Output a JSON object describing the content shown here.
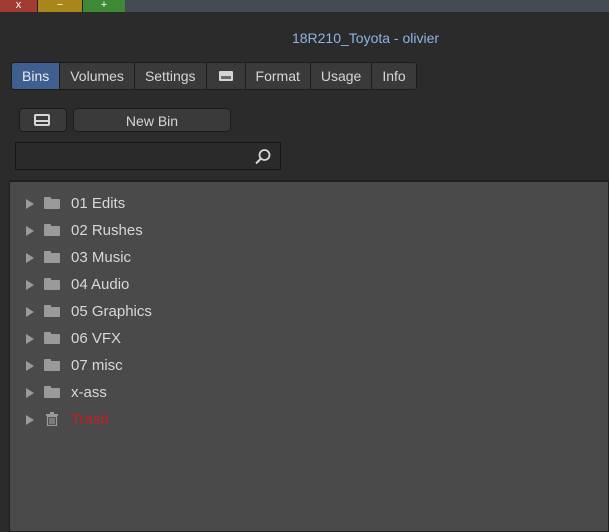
{
  "window": {
    "buttons": {
      "close": "x",
      "minimize": "−",
      "maximize": "+"
    },
    "title": "18R210_Toyota - olivier"
  },
  "tabs": [
    {
      "label": "Bins",
      "active": true
    },
    {
      "label": "Volumes",
      "active": false
    },
    {
      "label": "Settings",
      "active": false
    },
    {
      "label": "",
      "icon": "monitor-icon",
      "active": false
    },
    {
      "label": "Format",
      "active": false
    },
    {
      "label": "Usage",
      "active": false
    },
    {
      "label": "Info",
      "active": false
    }
  ],
  "toolbar": {
    "layout_icon": "layout-split-icon",
    "new_bin_label": "New Bin"
  },
  "search": {
    "value": "",
    "placeholder": "",
    "icon": "search-icon"
  },
  "bins": [
    {
      "label": "01 Edits",
      "icon": "folder-icon"
    },
    {
      "label": "02 Rushes",
      "icon": "folder-icon"
    },
    {
      "label": "03 Music",
      "icon": "folder-icon"
    },
    {
      "label": "04 Audio",
      "icon": "folder-icon"
    },
    {
      "label": "05 Graphics",
      "icon": "folder-icon"
    },
    {
      "label": "06 VFX",
      "icon": "folder-icon"
    },
    {
      "label": "07 misc",
      "icon": "folder-icon"
    },
    {
      "label": "x-ass",
      "icon": "folder-icon"
    },
    {
      "label": "Trash",
      "icon": "trash-icon",
      "color": "#c61e1e"
    }
  ]
}
